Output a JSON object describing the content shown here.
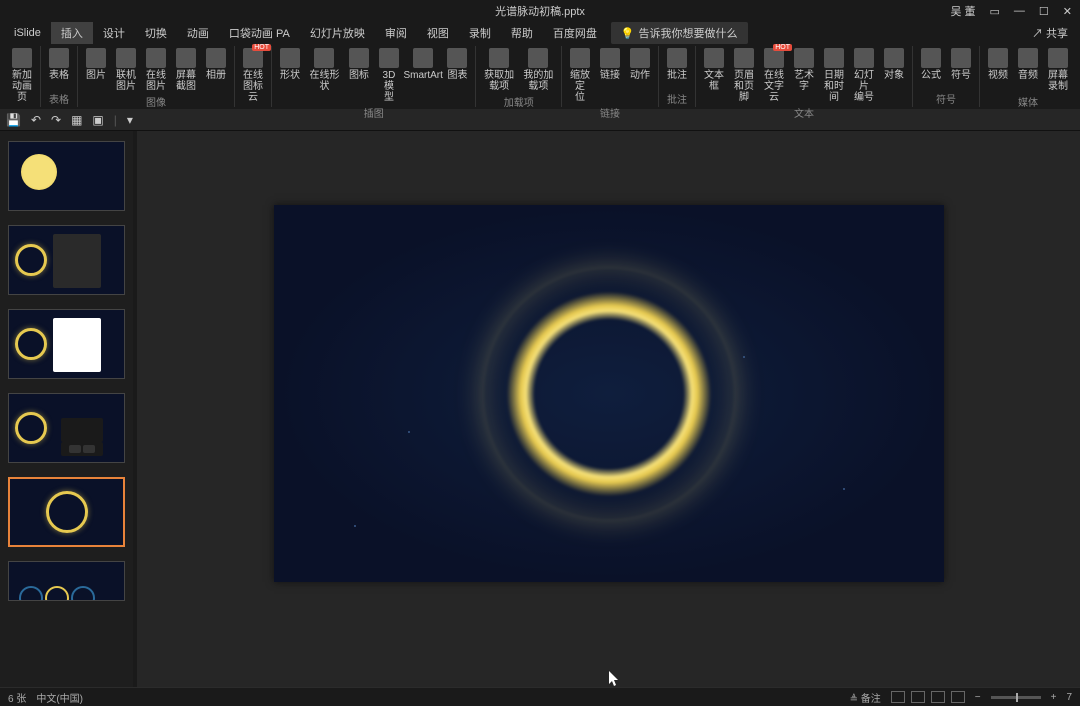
{
  "titlebar": {
    "filename": "光谱脉动初稿.pptx",
    "user": "吴 董",
    "share": "共享"
  },
  "menu": {
    "items": [
      "iSlide",
      "插入",
      "设计",
      "切换",
      "动画",
      "口袋动画 PA",
      "幻灯片放映",
      "审阅",
      "视图",
      "录制",
      "帮助",
      "百度网盘"
    ],
    "active_index": 1,
    "tell_me": "告诉我你想要做什么"
  },
  "ribbon": {
    "groups": [
      {
        "label": "",
        "items": [
          {
            "l": "新加\n动画页"
          }
        ]
      },
      {
        "label": "表格",
        "items": [
          {
            "l": "表格"
          }
        ]
      },
      {
        "label": "图像",
        "items": [
          {
            "l": "图片"
          },
          {
            "l": "联机图片"
          },
          {
            "l": "在线图片"
          },
          {
            "l": "屏幕截图"
          },
          {
            "l": "相册"
          }
        ]
      },
      {
        "label": "",
        "items": [
          {
            "l": "在线\n图标云",
            "hot": true
          }
        ]
      },
      {
        "label": "插图",
        "items": [
          {
            "l": "形状"
          },
          {
            "l": "在线形状"
          },
          {
            "l": "图标"
          },
          {
            "l": "3D 模\n型"
          },
          {
            "l": "SmartArt"
          },
          {
            "l": "图表"
          }
        ]
      },
      {
        "label": "加载项",
        "items": [
          {
            "l": "获取加载项",
            "icon": "store"
          },
          {
            "l": "我的加载项",
            "icon": "myapps"
          }
        ]
      },
      {
        "label": "链接",
        "items": [
          {
            "l": "缩放定\n位"
          },
          {
            "l": "链接"
          },
          {
            "l": "动作"
          }
        ]
      },
      {
        "label": "批注",
        "items": [
          {
            "l": "批注"
          }
        ]
      },
      {
        "label": "文本",
        "items": [
          {
            "l": "文本框"
          },
          {
            "l": "页眉和页脚"
          },
          {
            "l": "在线\n文字云",
            "hot": true
          },
          {
            "l": "艺术字"
          },
          {
            "l": "日期和时间"
          },
          {
            "l": "幻灯片\n编号"
          },
          {
            "l": "对象"
          }
        ]
      },
      {
        "label": "符号",
        "items": [
          {
            "l": "公式"
          },
          {
            "l": "符号"
          }
        ]
      },
      {
        "label": "媒体",
        "items": [
          {
            "l": "视频"
          },
          {
            "l": "音频"
          },
          {
            "l": "屏幕\n录制"
          }
        ]
      }
    ]
  },
  "status": {
    "slide": "6 张",
    "lang": "中文(中国)",
    "notes": "备注",
    "zoom": "7"
  },
  "slides": {
    "count": 6,
    "selected": 5
  }
}
